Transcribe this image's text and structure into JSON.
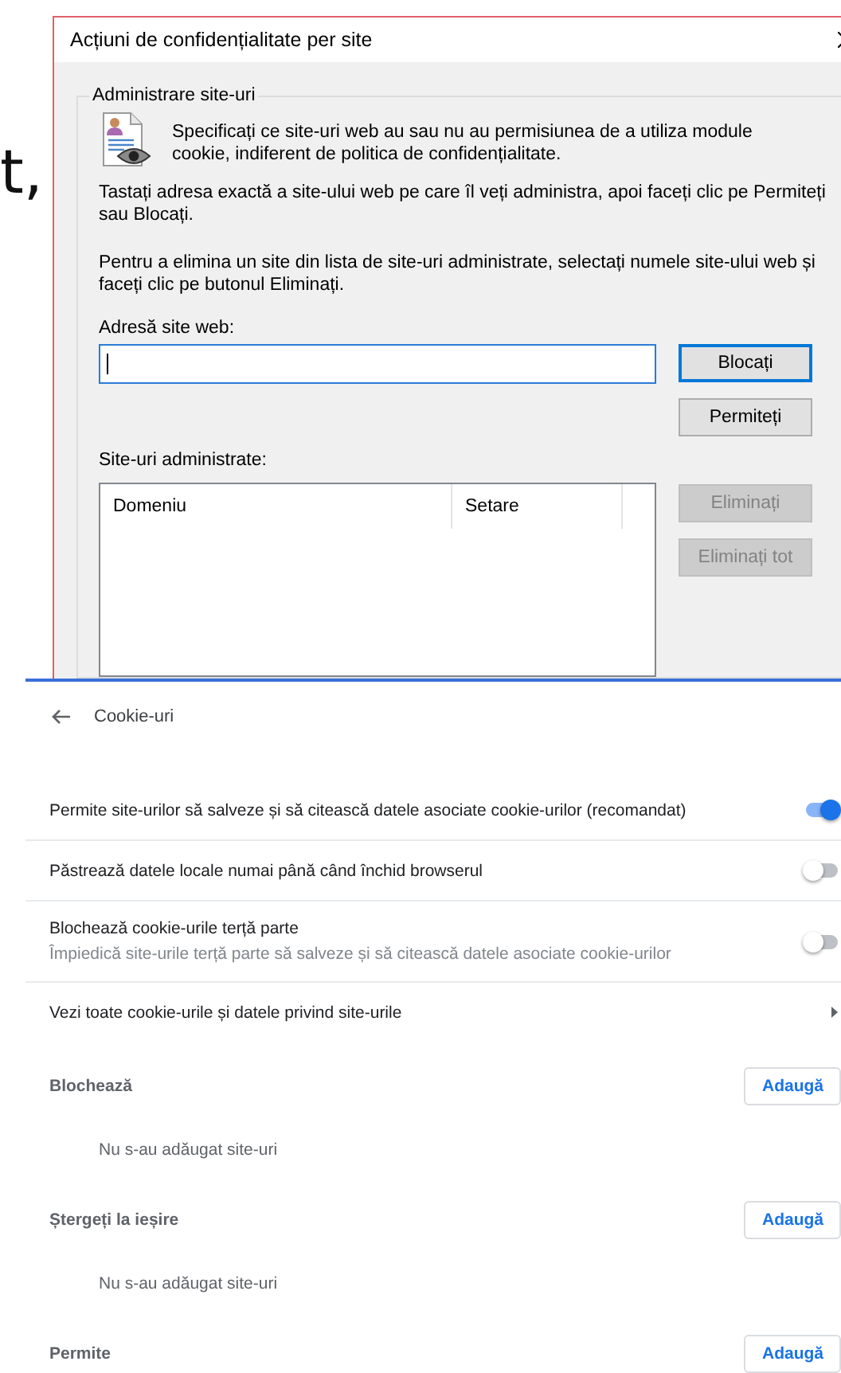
{
  "background_text": "t,",
  "dialog": {
    "title": "Acțiuni de confidențialitate per site",
    "group_label": "Administrare site-uri",
    "intro": "Specificați ce site-uri web au sau nu au permisiunea de a utiliza module cookie, indiferent de politica de confidențialitate.",
    "instructions": [
      "Tastați adresa exactă a site-ului web pe care îl veți administra, apoi faceți clic pe Permiteți sau Blocați.",
      "Pentru a elimina un site din lista de site-uri administrate, selectați numele site-ului web și faceți clic pe butonul Eliminați."
    ],
    "address_label": "Adresă site web:",
    "list_label": "Site-uri administrate:",
    "columns": [
      "Domeniu",
      "Setare"
    ],
    "buttons": [
      {
        "label": "Blocați",
        "disabled": false,
        "default": true
      },
      {
        "label": "Permiteți",
        "disabled": false,
        "default": false
      },
      {
        "label": "Eliminați",
        "disabled": true,
        "default": false
      },
      {
        "label": "Eliminați tot",
        "disabled": true,
        "default": false
      }
    ]
  },
  "settings": {
    "title": "Cookie-uri",
    "rows": [
      {
        "kind": "toggle",
        "label": "Permite site-urilor să salveze și să citească datele asociate cookie-urilor (recomandat)",
        "on": true
      },
      {
        "kind": "toggle",
        "label": "Păstrează datele locale numai până când închid browserul",
        "on": false
      },
      {
        "kind": "toggle",
        "label": "Blochează cookie-urile terță parte",
        "description": "Împiedică site-urile terță parte să salveze și să citească datele asociate cookie-urilor",
        "on": false
      },
      {
        "kind": "link",
        "label": "Vezi toate cookie-urile și datele privind site-urile"
      }
    ],
    "sections": [
      {
        "title": "Blochează",
        "button": "Adaugă",
        "empty_text": "Nu s-au adăugat site-uri"
      },
      {
        "title": "Ștergeți la ieșire",
        "button": "Adaugă",
        "empty_text": "Nu s-au adăugat site-uri"
      },
      {
        "title": "Permite",
        "button": "Adaugă"
      }
    ]
  }
}
